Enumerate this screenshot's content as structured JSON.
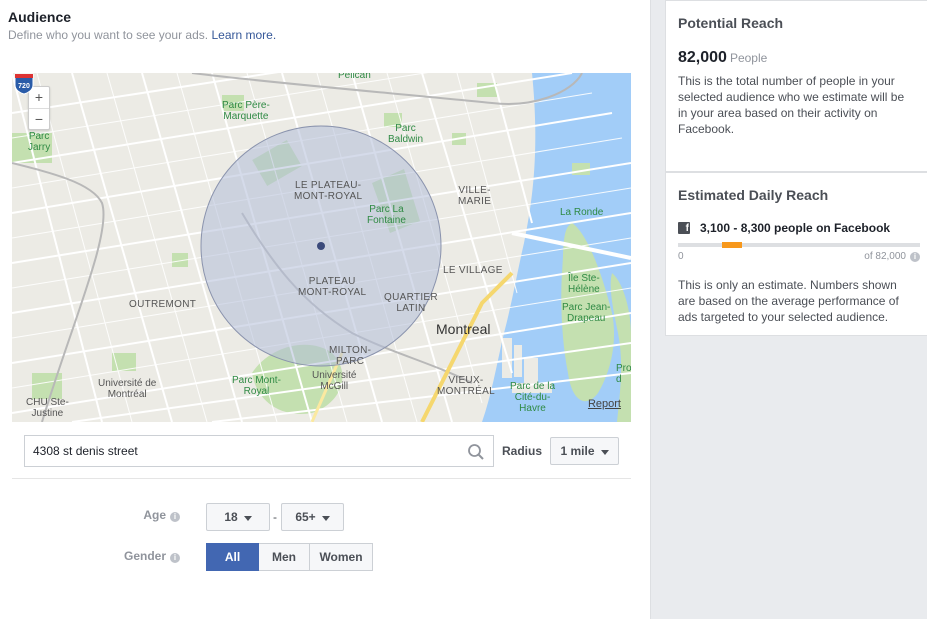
{
  "audience": {
    "title": "Audience",
    "subtitle": "Define who you want to see your ads.",
    "learn_more": "Learn more."
  },
  "map": {
    "zoom_in": "+",
    "zoom_out": "−",
    "report": "Report",
    "highway_shield": "720",
    "labels": {
      "pelican": "Pelican",
      "parc_pere_marquette": "Parc Père-\nMarquette",
      "parc_jarry": "Parc\nJarry",
      "parc_baldwin": "Parc\nBaldwin",
      "plateau_mont_royal_upper": "LE PLATEAU-\nMONT-ROYAL",
      "parc_la_fontaine": "Parc La\nFontaine",
      "ville_marie": "VILLE-\nMARIE",
      "la_ronde": "La Ronde",
      "le_village": "LE VILLAGE",
      "plateau_mont_royal": "PLATEAU\nMONT-ROYAL",
      "quartier_latin": "QUARTIER\nLATIN",
      "outremont": "OUTREMONT",
      "montreal": "Montreal",
      "ile_ste_helene": "Île Ste-\nHélène",
      "parc_jean_drapeau": "Parc Jean-\nDrapeau",
      "milton_parc": "MILTON-\nPARC",
      "universite_mcgill": "Université\nMcGill",
      "parc_mont_royal": "Parc Mont-\nRoyal",
      "universite_de_montreal": "Université de\nMontréal",
      "chu_ste_justine": "CHU Ste-\nJustine",
      "vieux_montreal": "VIEUX-\nMONTRÉAL",
      "parc_cite_du_havre": "Parc de la\nCité-du-\nHavre",
      "pro_edge": "Pro\nd"
    },
    "colors": {
      "land": "#ecebe5",
      "water": "#a2cdf8",
      "park": "#c4e0b0",
      "radius_fill": "#b3bdd9",
      "radius_stroke": "#8a93ad",
      "pin": "#3b4a7a"
    }
  },
  "search": {
    "value": "4308 st denis street",
    "placeholder": "Search"
  },
  "radius": {
    "label": "Radius",
    "value": "1 mile"
  },
  "age": {
    "label": "Age",
    "min": "18",
    "separator": "-",
    "max": "65+"
  },
  "gender": {
    "label": "Gender",
    "options": [
      "All",
      "Men",
      "Women"
    ],
    "selected": "All"
  },
  "potential_reach": {
    "title": "Potential Reach",
    "number": "82,000",
    "unit": "People",
    "description": "This is the total number of people in your selected audience who we estimate will be in your area based on their activity on Facebook."
  },
  "daily_reach": {
    "title": "Estimated Daily Reach",
    "range_text": "3,100 - 8,300 people on Facebook",
    "scale_min": "0",
    "scale_max": "of 82,000",
    "range_low": 3100,
    "range_high": 8300,
    "total": 82000,
    "bar_color": "#f7981c",
    "description": "This is only an estimate. Numbers shown are based on the average performance of ads targeted to your selected audience."
  }
}
